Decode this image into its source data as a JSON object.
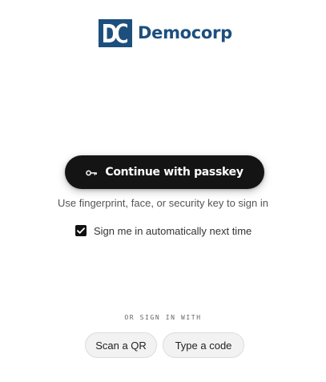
{
  "brand": {
    "monogram": "DC",
    "name": "Democorp",
    "color": "#1d4f7d"
  },
  "passkey": {
    "icon": "key-icon",
    "label": "Continue with passkey"
  },
  "helper_text": "Use fingerprint, face, or security key to sign in",
  "remember": {
    "checked": true,
    "label": "Sign me in automatically next time"
  },
  "alternatives": {
    "heading": "OR SIGN IN WITH",
    "options": [
      {
        "label": "Scan a QR"
      },
      {
        "label": "Type a code"
      }
    ]
  }
}
